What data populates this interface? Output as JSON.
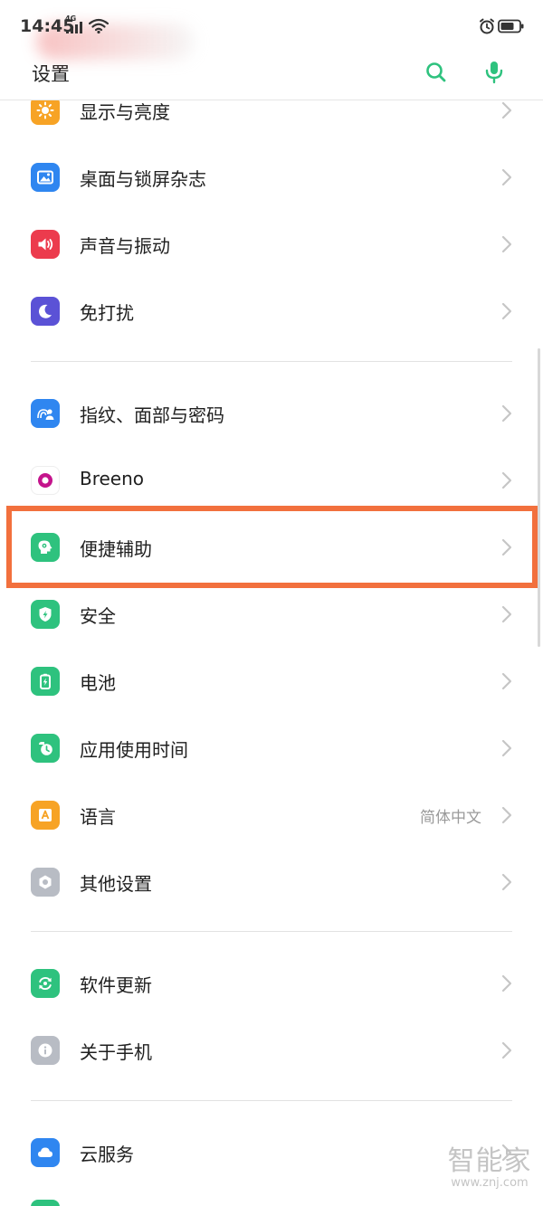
{
  "status_bar": {
    "time": "14:45",
    "network": "4G"
  },
  "header": {
    "title": "设置"
  },
  "items": [
    {
      "label": "显示与亮度",
      "icon": "brightness-icon",
      "color": "#f7a325"
    },
    {
      "label": "桌面与锁屏杂志",
      "icon": "wallpaper-icon",
      "color": "#2f86f0"
    },
    {
      "label": "声音与振动",
      "icon": "speaker-icon",
      "color": "#ec3b4d"
    },
    {
      "label": "免打扰",
      "icon": "moon-icon",
      "color": "#5b52d6"
    },
    {
      "label": "指纹、面部与密码",
      "icon": "fingerprint-face-icon",
      "color": "#2f86f0"
    },
    {
      "label": "Breeno",
      "icon": "breeno-icon",
      "color": "#c4148c"
    },
    {
      "label": "便捷辅助",
      "icon": "assist-head-icon",
      "color": "#2ec27e"
    },
    {
      "label": "安全",
      "icon": "shield-icon",
      "color": "#2ec27e"
    },
    {
      "label": "电池",
      "icon": "battery-icon",
      "color": "#2ec27e"
    },
    {
      "label": "应用使用时间",
      "icon": "app-usage-clock-icon",
      "color": "#2ec27e"
    },
    {
      "label": "语言",
      "value": "简体中文",
      "icon": "language-icon",
      "color": "#f7a325"
    },
    {
      "label": "其他设置",
      "icon": "other-settings-icon",
      "color": "#b8bcc4"
    },
    {
      "label": "软件更新",
      "icon": "update-icon",
      "color": "#2ec27e"
    },
    {
      "label": "关于手机",
      "icon": "info-icon",
      "color": "#b8bcc4"
    },
    {
      "label": "云服务",
      "icon": "cloud-icon",
      "color": "#2f86f0"
    }
  ],
  "colors": {
    "accent_green": "#2ec27e",
    "highlight_border": "#f2703d"
  },
  "watermark": {
    "text": "智能家",
    "url": "www.znj.com"
  }
}
